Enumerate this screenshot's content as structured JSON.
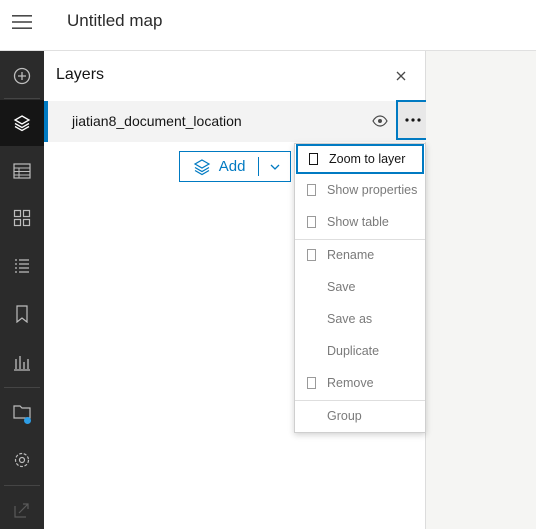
{
  "header": {
    "title": "Untitled map",
    "menu_icon": "hamburger-icon"
  },
  "actionbar": {
    "items": [
      {
        "icon": "add-circle-icon"
      },
      {
        "icon": "layers-icon",
        "active": true
      },
      {
        "icon": "table-icon"
      },
      {
        "icon": "basemap-grid-icon"
      },
      {
        "icon": "legend-list-icon"
      },
      {
        "icon": "bookmark-icon"
      },
      {
        "icon": "chart-icon"
      },
      {
        "icon": "folder-icon",
        "badge_color": "#2e9ee6"
      },
      {
        "icon": "gear-icon"
      },
      {
        "icon": "share-icon"
      }
    ]
  },
  "panel": {
    "title": "Layers",
    "close_icon": "close-icon"
  },
  "layer": {
    "name": "jiatian8_document_location",
    "visibility_icon": "eye-icon",
    "options_icon": "more-dots-icon"
  },
  "add_button": {
    "label": "Add",
    "icon": "layers-add-icon",
    "dropdown_icon": "chevron-down-icon"
  },
  "menu": {
    "items": [
      {
        "label": "Zoom to layer",
        "has_icon": true
      },
      {
        "label": "Show properties",
        "has_icon": true
      },
      {
        "label": "Show table",
        "has_icon": true
      },
      {
        "label": "Rename",
        "has_icon": true
      },
      {
        "label": "Save",
        "has_icon": false
      },
      {
        "label": "Save as",
        "has_icon": false
      },
      {
        "label": "Duplicate",
        "has_icon": false
      },
      {
        "label": "Remove",
        "has_icon": true
      },
      {
        "label": "Group",
        "has_icon": false
      }
    ]
  },
  "colors": {
    "accent": "#007ac2",
    "actionbar": "#2b2b2b",
    "actionbar_active": "#151515"
  }
}
